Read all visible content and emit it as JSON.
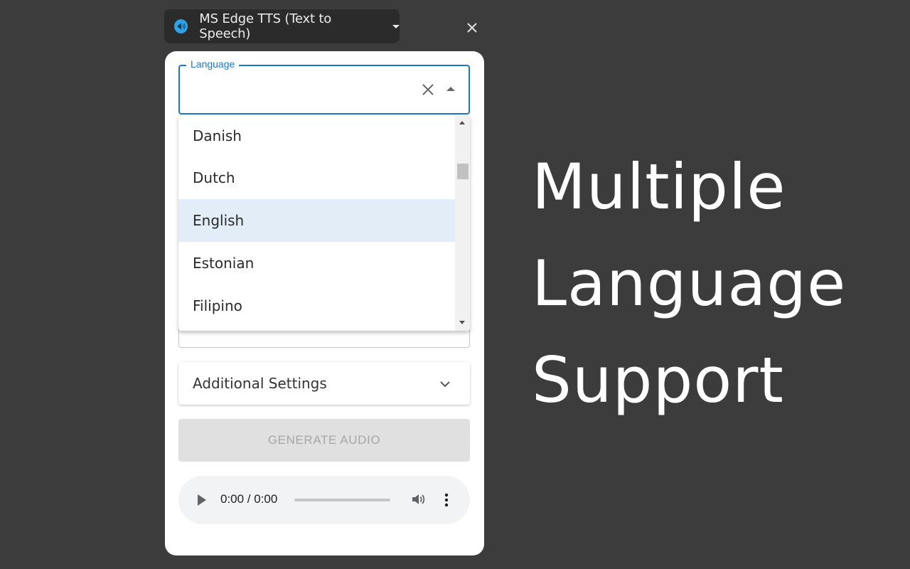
{
  "extension": {
    "title": "MS Edge TTS (Text to Speech)",
    "icon": "speaker-icon",
    "accent": "#2fa3e6"
  },
  "language_field": {
    "label": "Language",
    "value": "",
    "accent": "#1976d2"
  },
  "dropdown": {
    "items": [
      {
        "label": "Danish"
      },
      {
        "label": "Dutch"
      },
      {
        "label": "English",
        "selected": true
      },
      {
        "label": "Estonian"
      },
      {
        "label": "Filipino"
      }
    ]
  },
  "accordion": {
    "label": "Additional Settings"
  },
  "generate": {
    "label": "GENERATE AUDIO",
    "disabled": true
  },
  "player": {
    "time": "0:00 / 0:00",
    "progress": 0
  },
  "promo": {
    "lines": [
      "Multiple",
      "Language",
      "Support"
    ]
  }
}
